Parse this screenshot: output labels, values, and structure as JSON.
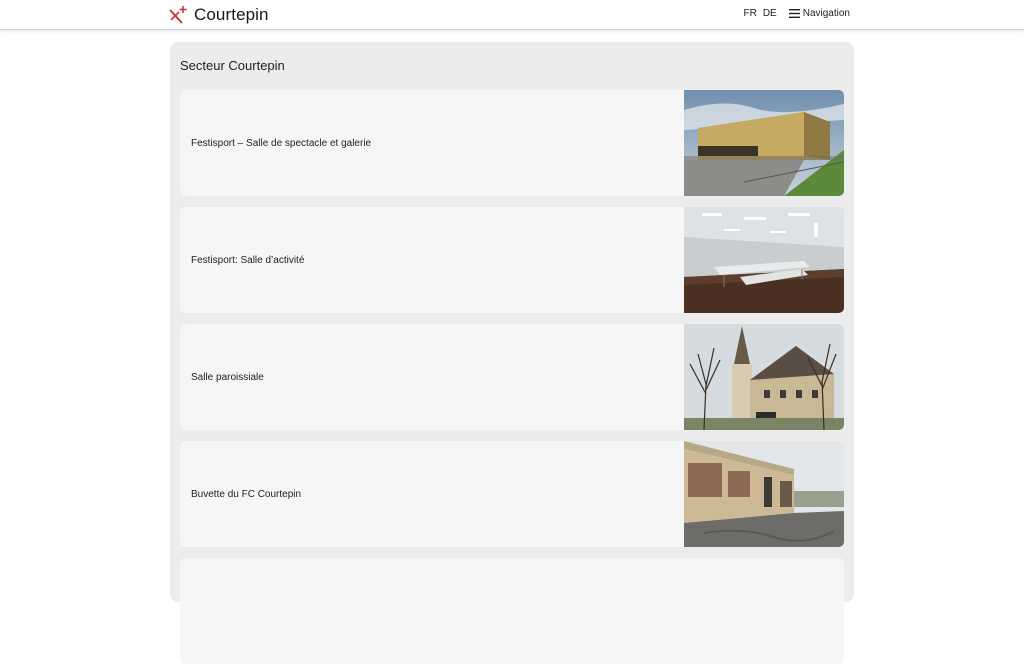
{
  "header": {
    "brand_name": "Courtepin",
    "lang_fr": "FR",
    "lang_de": "DE",
    "menu_label": "Navigation",
    "accent_color": "#d0333a"
  },
  "section": {
    "title": "Secteur Courtepin",
    "items": [
      {
        "label": "Festisport – Salle de spectacle et galerie",
        "image_icon": "building-photo"
      },
      {
        "label": "Festisport: Salle d’activité",
        "image_icon": "hall-photo"
      },
      {
        "label": "Salle paroissiale",
        "image_icon": "church-photo"
      },
      {
        "label": "Buvette du FC Courtepin",
        "image_icon": "clubhouse-photo"
      }
    ]
  }
}
